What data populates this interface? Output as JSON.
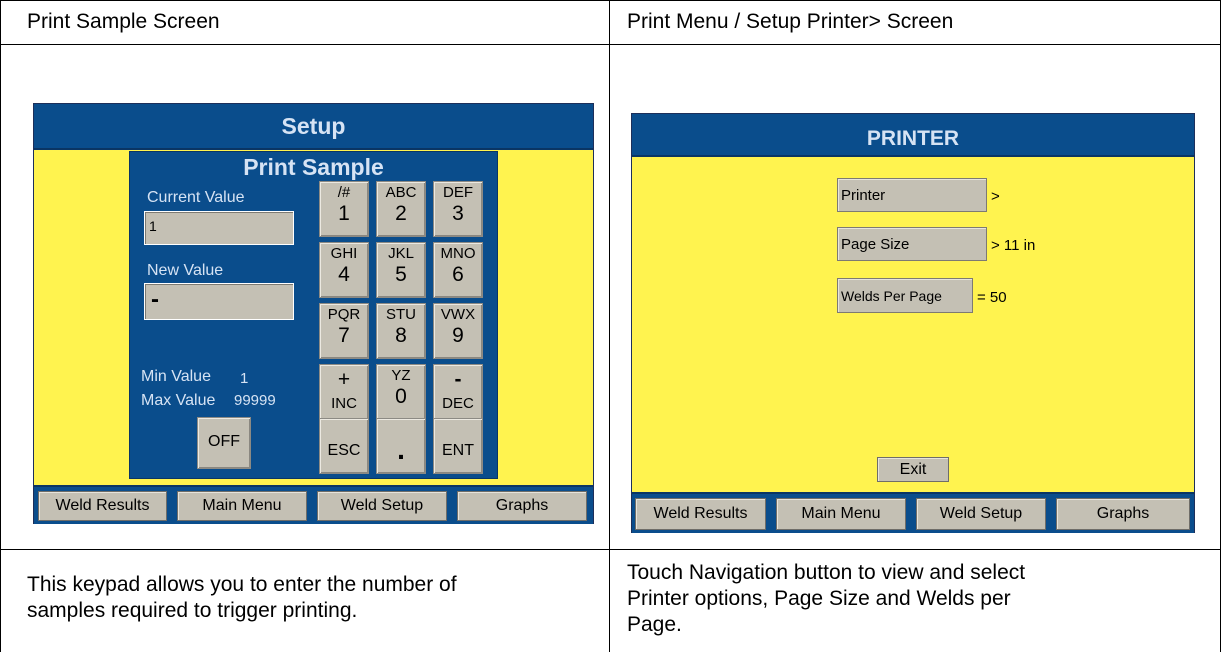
{
  "headers": {
    "left": "Print Sample Screen",
    "right": "Print Menu / Setup Printer> Screen"
  },
  "descriptions": {
    "left_line1": "This keypad allows you to enter the number of",
    "left_line2": "samples required to trigger printing.",
    "right_line1": "Touch Navigation button to view and select",
    "right_line2": "Printer options, Page Size and Welds per",
    "right_line3": "Page."
  },
  "left_screen": {
    "title": "Setup",
    "keypad": {
      "title": "Print Sample",
      "current_value_label": "Current Value",
      "current_value": "1",
      "new_value_label": "New Value",
      "new_value": "-",
      "min_label": "Min Value",
      "min_value": "1",
      "max_label": "Max Value",
      "max_value": "99999",
      "off_label": "OFF",
      "keys": {
        "k1_top": "/#",
        "k1_main": "1",
        "k2_top": "ABC",
        "k2_main": "2",
        "k3_top": "DEF",
        "k3_main": "3",
        "k4_top": "GHI",
        "k4_main": "4",
        "k5_top": "JKL",
        "k5_main": "5",
        "k6_top": "MNO",
        "k6_main": "6",
        "k7_top": "PQR",
        "k7_main": "7",
        "k8_top": "STU",
        "k8_main": "8",
        "k9_top": "VWX",
        "k9_main": "9",
        "inc_top": "+",
        "inc_sub": "INC",
        "k0_top": "YZ",
        "k0_main": "0",
        "dec_top": "-",
        "dec_sub": "DEC",
        "esc": "ESC",
        "dot": ".",
        "ent": "ENT"
      }
    },
    "nav": {
      "weld_results": "Weld Results",
      "main_menu": "Main Menu",
      "weld_setup": "Weld Setup",
      "graphs": "Graphs"
    }
  },
  "right_screen": {
    "title": "PRINTER",
    "items": {
      "printer_label": "Printer",
      "printer_value": ">",
      "page_size_label": "Page Size",
      "page_size_value": "> 11 in",
      "welds_per_page_label": "Welds Per Page",
      "welds_per_page_value": "= 50"
    },
    "exit_label": "Exit",
    "nav": {
      "weld_results": "Weld Results",
      "main_menu": "Main Menu",
      "weld_setup": "Weld Setup",
      "graphs": "Graphs"
    }
  },
  "colors": {
    "panel_blue": "#0a4d8c",
    "screen_yellow": "#fff34f",
    "button_gray": "#c4c0b4",
    "title_text": "#d6e3f4"
  }
}
